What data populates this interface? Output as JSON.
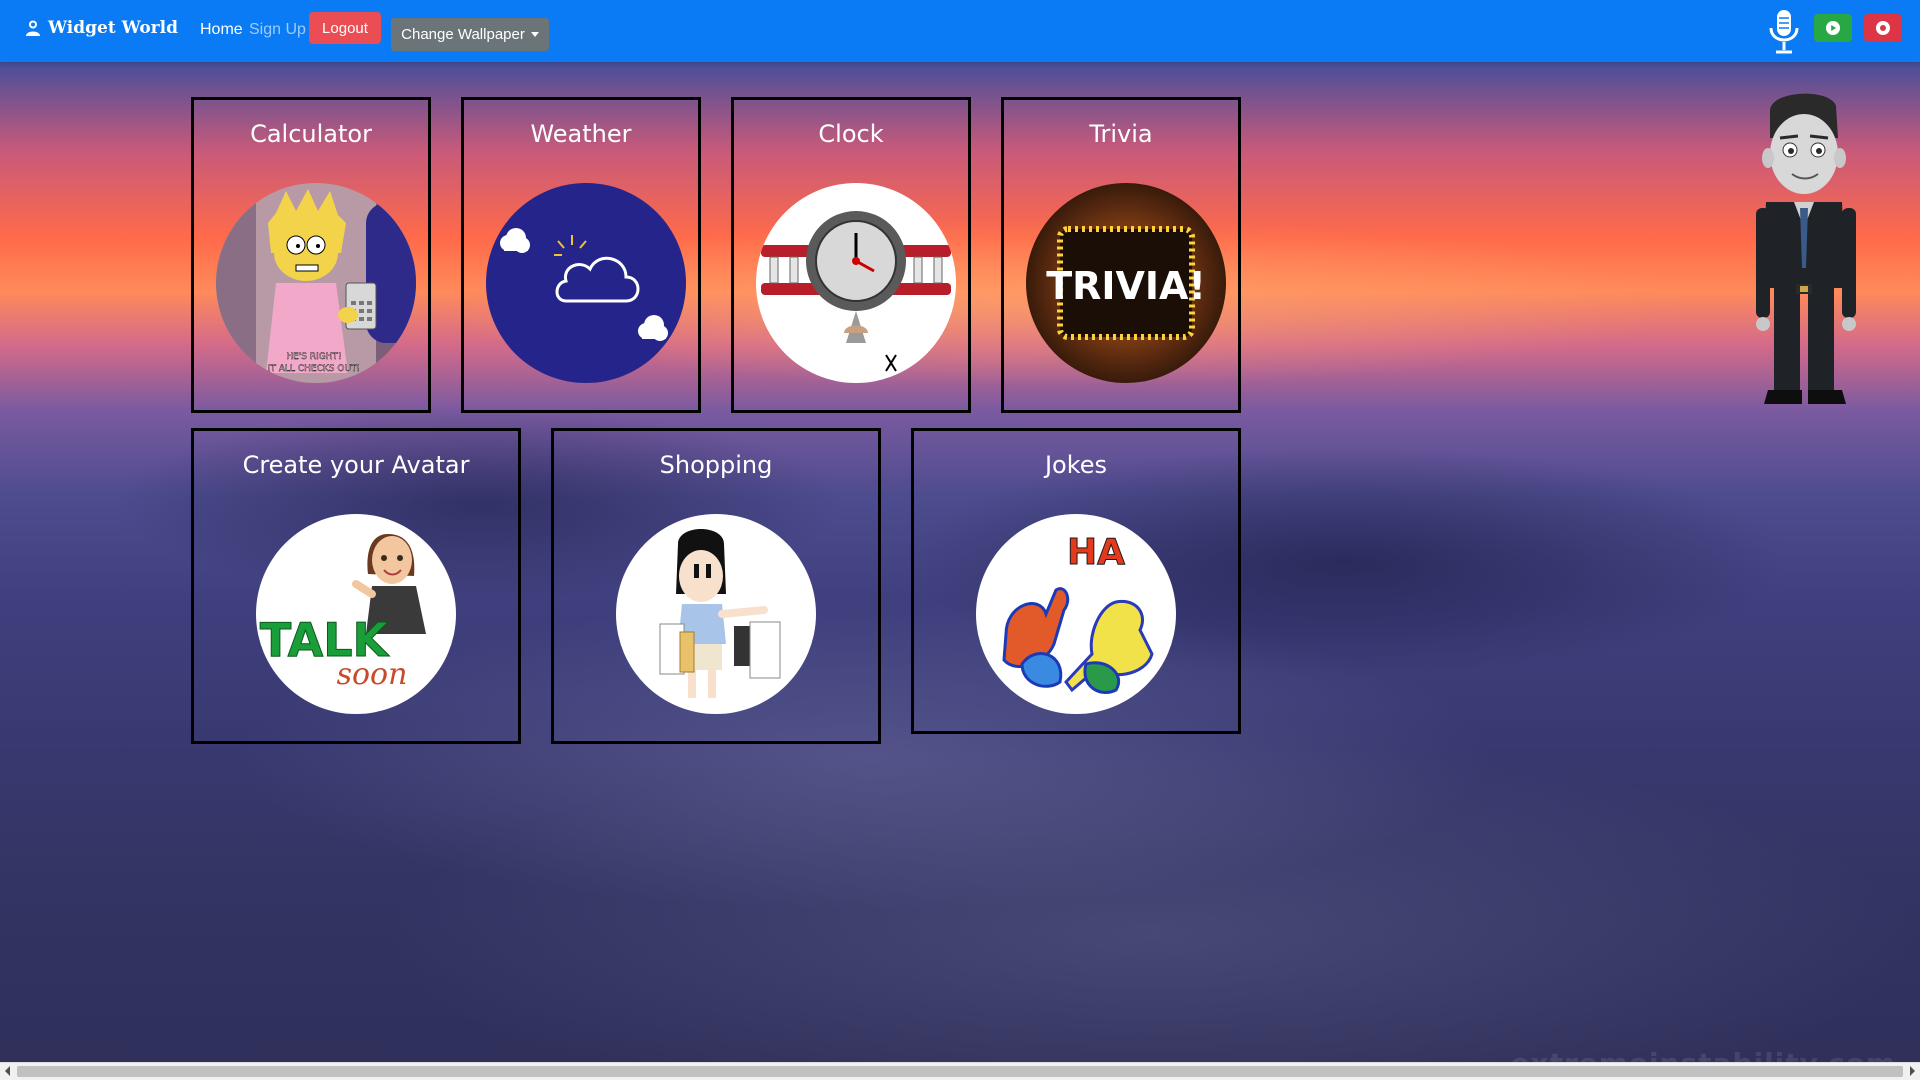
{
  "navbar": {
    "brand": "Widget World",
    "brand_icon": "user-icon",
    "home_label": "Home",
    "signup_label": "Sign Up",
    "logout_label": "Logout",
    "wallpaper_label": "Change Wallpaper",
    "mic_icon": "microphone-icon",
    "play_icon": "play-icon",
    "record_icon": "record-icon",
    "colors": {
      "navbar": "#0a7bf4",
      "logout": "#ea4d53",
      "wallpaper": "#6b7579",
      "play": "#28a745",
      "record": "#dc3545"
    }
  },
  "widgets": [
    {
      "title": "Calculator",
      "image": "cartoon-girl-with-calculator-image",
      "caption_lines": [
        "HE'S RIGHT!",
        "IT ALL CHECKS OUT!"
      ]
    },
    {
      "title": "Weather",
      "image": "weather-cloud-image"
    },
    {
      "title": "Clock",
      "image": "airplane-clock-image"
    },
    {
      "title": "Trivia",
      "image": "trivia-marquee-image",
      "image_text": "TRIVIA!"
    },
    {
      "title": "Create your Avatar",
      "image": "talk-soon-avatar-image",
      "image_text_1": "TALK",
      "image_text_2": "soon"
    },
    {
      "title": "Shopping",
      "image": "shopping-girl-image"
    },
    {
      "title": "Jokes",
      "image": "laughing-figures-image",
      "image_text": "HA"
    }
  ],
  "avatar": {
    "image": "standing-man-avatar-image"
  },
  "watermark": "extremeinstability.com"
}
